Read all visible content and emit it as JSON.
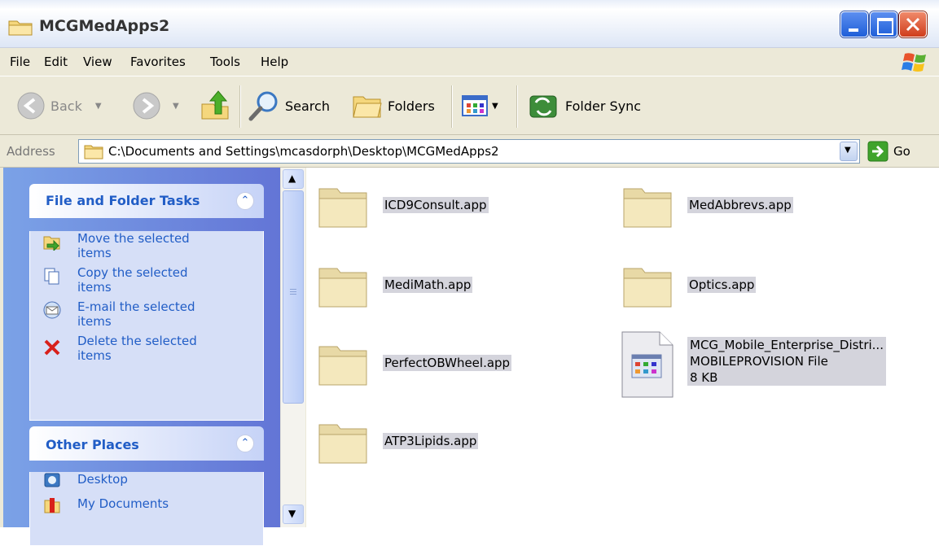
{
  "window": {
    "title": "MCGMedApps2"
  },
  "menu": {
    "items": [
      "File",
      "Edit",
      "View",
      "Favorites",
      "Tools",
      "Help"
    ]
  },
  "toolbar": {
    "back_label": "Back",
    "search_label": "Search",
    "folders_label": "Folders",
    "folder_sync_label": "Folder Sync"
  },
  "address": {
    "label": "Address",
    "path": "C:\\Documents and Settings\\mcasdorph\\Desktop\\MCGMedApps2",
    "go_label": "Go"
  },
  "tasks_panel": {
    "title": "File and Folder Tasks",
    "tasks": [
      {
        "line1": "Move the selected",
        "line2": "items"
      },
      {
        "line1": "Copy the selected",
        "line2": "items"
      },
      {
        "line1": "E-mail the selected",
        "line2": "items"
      },
      {
        "line1": "Delete the selected",
        "line2": "items"
      }
    ]
  },
  "places_panel": {
    "title": "Other Places",
    "places": [
      "Desktop",
      "My Documents"
    ]
  },
  "files": [
    {
      "name": "ICD9Consult.app"
    },
    {
      "name": "MedAbbrevs.app"
    },
    {
      "name": "MediMath.app"
    },
    {
      "name": "Optics.app"
    },
    {
      "name": "PerfectOBWheel.app"
    },
    {
      "name": "MCG_Mobile_Enterprise_Distri...",
      "type": "MOBILEPROVISION File",
      "size": "8 KB"
    },
    {
      "name": "ATP3Lipids.app"
    }
  ],
  "colors": {
    "titlebar": "#ffffff",
    "task_link": "#215dc6",
    "selection": "#d4d4dc"
  }
}
